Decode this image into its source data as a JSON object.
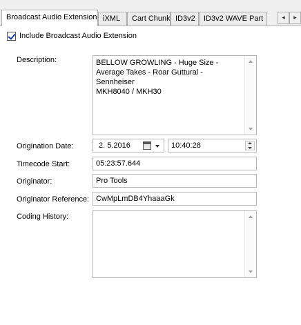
{
  "tabs": [
    {
      "label": "Broadcast Audio Extension",
      "active": true
    },
    {
      "label": "iXML",
      "active": false
    },
    {
      "label": "Cart Chunk",
      "active": false
    },
    {
      "label": "ID3v2",
      "active": false
    },
    {
      "label": "ID3v2 WAVE Part",
      "active": false
    }
  ],
  "tab_scroll": {
    "left": "◂",
    "right": "▸"
  },
  "include_bext": {
    "label": "Include Broadcast Audio Extension",
    "checked": true
  },
  "form": {
    "description_label": "Description:",
    "description_value": "BELLOW GROWLING - Huge Size -\nAverage Takes - Roar Guttural - Sennheiser\nMKH8040 / MKH30",
    "origination_date_label": "Origination Date:",
    "origination_date_value": "2.  5.2016",
    "origination_time_value": "10:40:28",
    "timecode_label": "Timecode Start:",
    "timecode_value": "05:23:57.644",
    "originator_label": "Originator:",
    "originator_value": "Pro Tools",
    "originator_ref_label": "Originator Reference:",
    "originator_ref_value": "CwMpLmDB4YhaaaGk",
    "coding_history_label": "Coding History:",
    "coding_history_value": ""
  }
}
